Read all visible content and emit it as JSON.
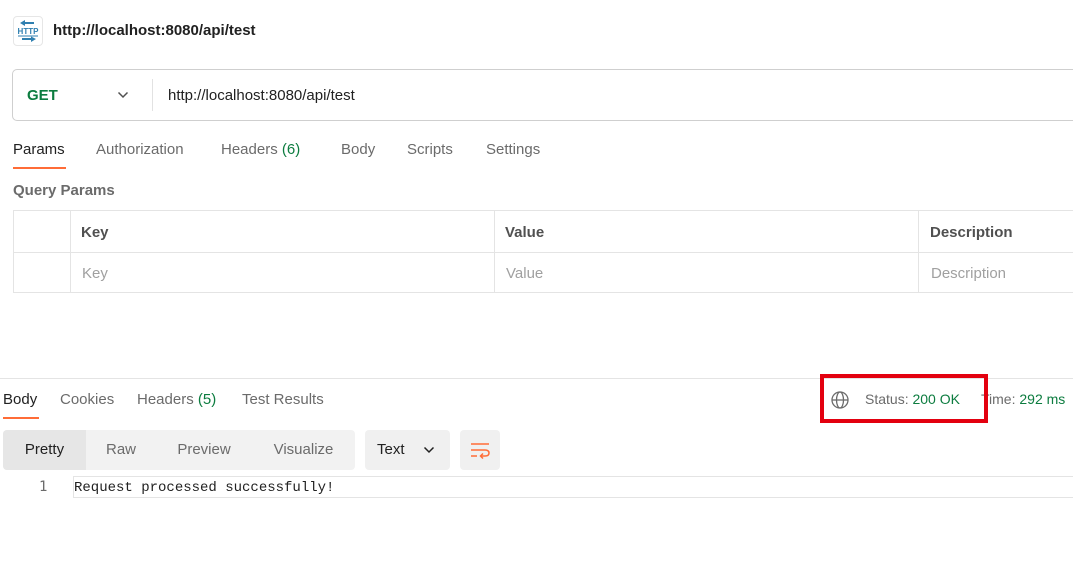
{
  "request": {
    "title": "http://localhost:8080/api/test",
    "icon": "http-request-icon",
    "method": "GET",
    "url": "http://localhost:8080/api/test"
  },
  "request_tabs": {
    "params": "Params",
    "authorization": "Authorization",
    "headers": "Headers",
    "headers_count": "(6)",
    "body": "Body",
    "scripts": "Scripts",
    "settings": "Settings"
  },
  "query_params": {
    "label": "Query Params",
    "columns": {
      "key": "Key",
      "value": "Value",
      "description": "Description"
    },
    "placeholder_row": {
      "key": "Key",
      "value": "Value",
      "description": "Description"
    }
  },
  "response_tabs": {
    "body": "Body",
    "cookies": "Cookies",
    "headers": "Headers",
    "headers_count": "(5)",
    "test_results": "Test Results"
  },
  "response_meta": {
    "status_label": "Status:",
    "status_value": "200 OK",
    "time_label": "Time:",
    "time_value": "292 ms"
  },
  "view_modes": {
    "pretty": "Pretty",
    "raw": "Raw",
    "preview": "Preview",
    "visualize": "Visualize",
    "active": "Pretty"
  },
  "format": {
    "selected": "Text"
  },
  "response_body": {
    "lines": [
      {
        "number": "1",
        "text": "Request processed successfully!"
      }
    ]
  },
  "colors": {
    "accent": "#ff6c37",
    "success": "#0c7c3f",
    "highlight": "#e3000f"
  }
}
